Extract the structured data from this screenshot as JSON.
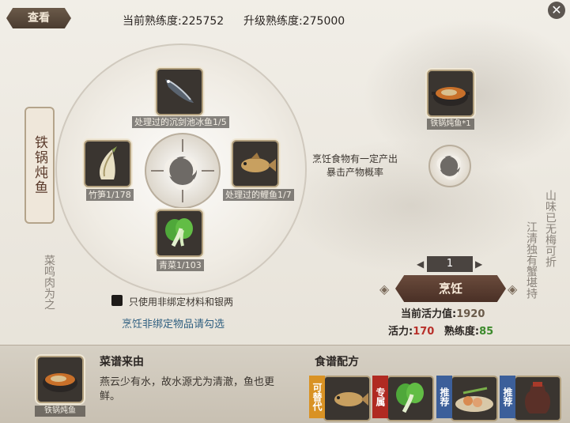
{
  "header": {
    "tab_label": "查看",
    "current_proficiency_label": "当前熟练度:",
    "current_proficiency_value": "225752",
    "upgrade_proficiency_label": "升级熟练度:",
    "upgrade_proficiency_value": "275000",
    "close_icon": "close-icon"
  },
  "dish": {
    "name": "铁锅炖鱼"
  },
  "ingredients": [
    {
      "label": "处理过的沉剑池冰鱼1/5",
      "icon": "fish-icon"
    },
    {
      "label": "竹笋1/178",
      "icon": "bamboo-shoot-icon"
    },
    {
      "label": "处理过的鲤鱼1/7",
      "icon": "carp-icon"
    },
    {
      "label": "青菜1/103",
      "icon": "greens-icon"
    }
  ],
  "output": {
    "label": "铁锅炖鱼*1",
    "hint": "烹饪食物有一定产出暴击产物概率"
  },
  "cook": {
    "quantity": "1",
    "button_label": "烹饪",
    "vitality_current_label": "当前活力值:",
    "vitality_current_value": "1920",
    "vitality_cost_label": "活力:",
    "vitality_cost_value": "170",
    "proficiency_gain_label": "熟练度:",
    "proficiency_gain_value": "85"
  },
  "options": {
    "checkbox_label": "只使用非绑定材料和银两",
    "unbound_hint": "烹饪非绑定物品请勾选"
  },
  "bottom": {
    "recipe_item_label": "铁锅炖鱼",
    "origin_title": "菜谱来由",
    "origin_text": "燕云少有水，故水源尤为清澈，鱼也更鲜。",
    "formula_title": "食谱配方",
    "badges": [
      "可替代",
      "专属",
      "推荐",
      "推荐"
    ]
  },
  "decor": {
    "left_calligraphy": "菜鸣肉为之",
    "right_calligraphy_1": "山味已无梅可折",
    "right_calligraphy_2": "江清独有蟹堪持"
  },
  "colors": {
    "vitality_cost": "#b8302a",
    "proficiency_gain": "#3c8a2c",
    "vitality_current": "#6a5a4a",
    "badge_orange": "#d99224",
    "badge_red": "#b02a22",
    "badge_blue": "#3c5f9a"
  }
}
